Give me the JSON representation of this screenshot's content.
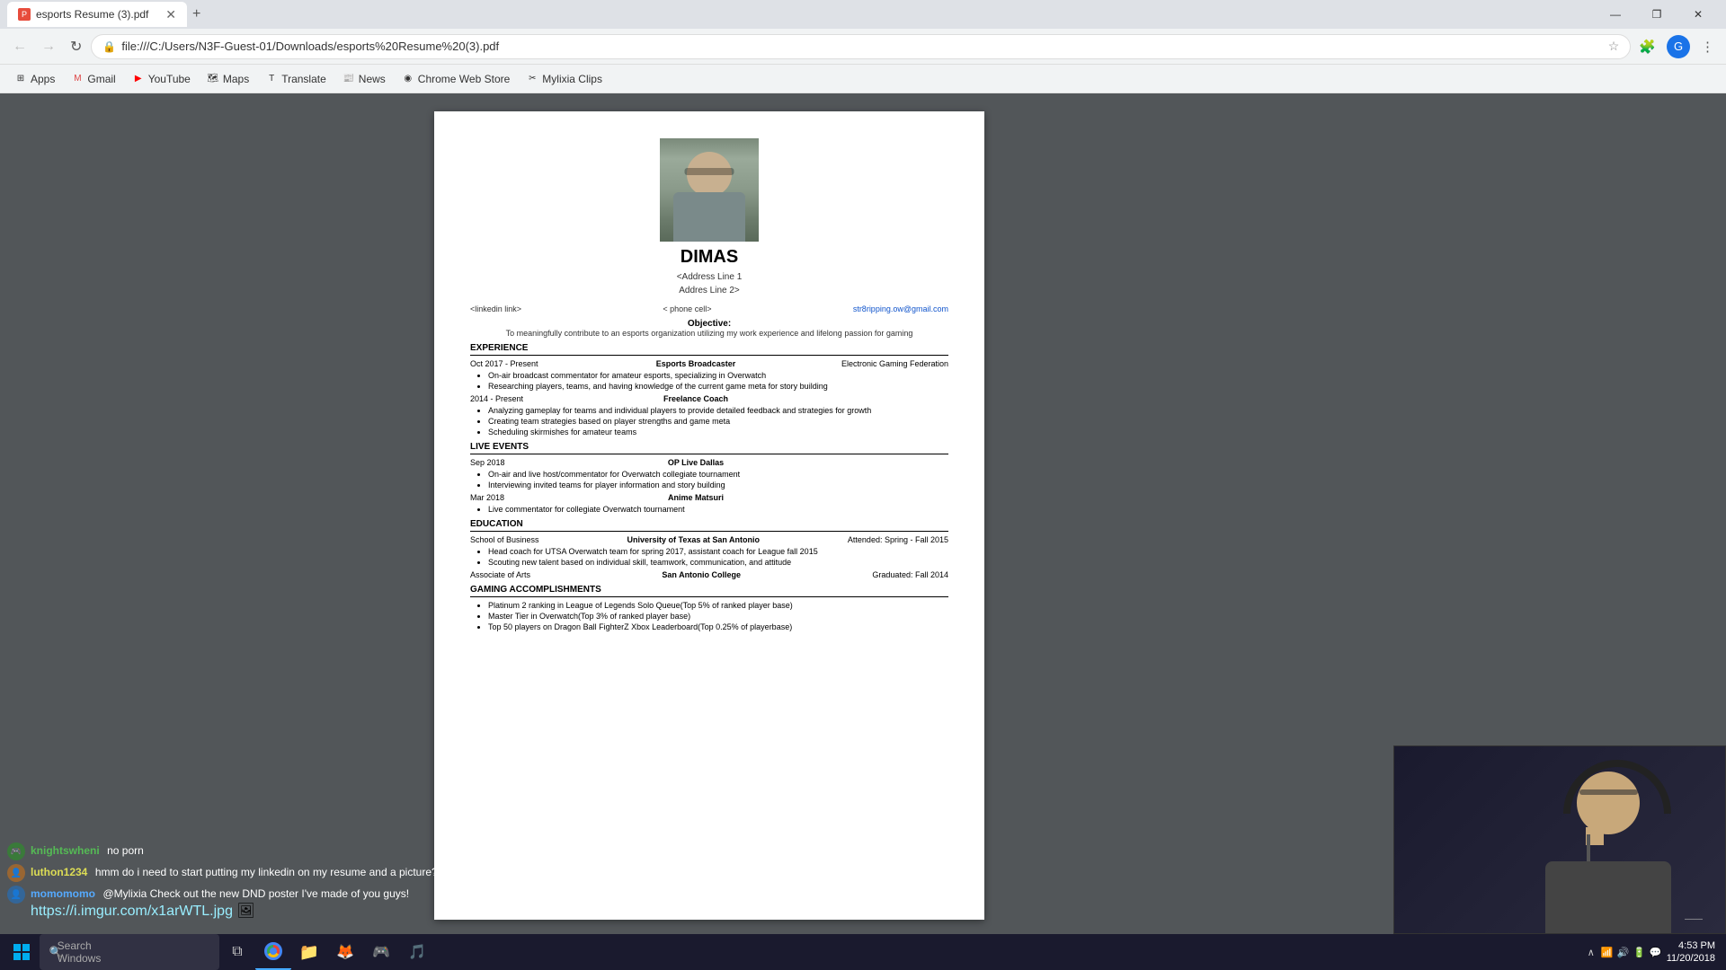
{
  "browser": {
    "tab": {
      "title": "esports Resume (3).pdf",
      "favicon": "pdf"
    },
    "add_tab_label": "+",
    "window_controls": [
      "—",
      "❐",
      "✕"
    ],
    "nav": {
      "back_disabled": true,
      "forward_disabled": true,
      "refresh_label": "↻",
      "address": "file:///C:/Users/N3F-Guest-01/Downloads/esports%20Resume%20(3).pdf",
      "lock_icon": "🔒"
    },
    "bookmarks": [
      {
        "label": "Apps",
        "icon": "⊞"
      },
      {
        "label": "Gmail",
        "icon": "M"
      },
      {
        "label": "YouTube",
        "icon": "▶"
      },
      {
        "label": "Maps",
        "icon": "📍"
      },
      {
        "label": "Translate",
        "icon": "T"
      },
      {
        "label": "News",
        "icon": "N"
      },
      {
        "label": "Chrome Web Store",
        "icon": "◉"
      },
      {
        "label": "Mylixia Clips",
        "icon": "✂"
      }
    ]
  },
  "resume": {
    "name": "DIMAS",
    "address_line1": "<Address Line 1",
    "address_line2": "Addres Line 2>",
    "linkedin": "<linkedin link>",
    "phone": "< phone cell>",
    "email": "str8ripping.ow@gmail.com",
    "objective_title": "Objective:",
    "objective_text": "To meaningfully contribute to an esports organization utilizing my work experience and lifelong passion for gaming",
    "experience_title": "EXPERIENCE",
    "experience": [
      {
        "date": "Oct 2017 - Present",
        "role": "Esports Broadcaster",
        "org": "Electronic Gaming Federation",
        "bullets": [
          "On-air broadcast commentator for amateur esports, specializing in Overwatch",
          "Researching players, teams, and having knowledge of the current game meta for story building"
        ]
      },
      {
        "date": "2014 - Present",
        "role": "Freelance Coach",
        "org": "",
        "bullets": [
          "Analyzing gameplay for teams and individual players to provide detailed feedback and strategies for growth",
          "Creating team strategies based on player strengths and game meta",
          "Scheduling skirmishes for amateur teams"
        ]
      }
    ],
    "live_events_title": "LIVE EVENTS",
    "live_events": [
      {
        "date": "Sep 2018",
        "event": "OP Live Dallas",
        "bullets": [
          "On-air and live host/commentator for Overwatch collegiate tournament",
          "Interviewing invited teams for player information and story building"
        ]
      },
      {
        "date": "Mar 2018",
        "event": "Anime Matsuri",
        "bullets": [
          "Live commentator for collegiate Overwatch tournament"
        ]
      }
    ],
    "education_title": "EDUCATION",
    "education": [
      {
        "school": "School of Business",
        "institution": "University of Texas at San Antonio",
        "date": "Attended: Spring - Fall 2015",
        "bullets": [
          "Head coach for UTSA Overwatch team for spring 2017, assistant coach for League fall 2015",
          "Scouting new talent based on individual skill, teamwork, communication, and attitude"
        ]
      },
      {
        "school": "Associate of Arts",
        "institution": "San Antonio College",
        "date": "Graduated: Fall 2014",
        "bullets": []
      }
    ],
    "gaming_title": "ING ACCOMPLISHMENTS",
    "gaming_bullets": [
      "Platinum 2 ranking in League of Legends Solo Queue(Top 5% of ranked player base)",
      "Master Tier in Overwatch(Top 3% of ranked player base)",
      "Top 50 players on Dragon Ball FighterZ Xbox Leaderboard(Top 0.25% of playerbase)"
    ]
  },
  "chat": {
    "messages": [
      {
        "username": "knightswheni",
        "username_color": "#5b5",
        "icon_color": "#3a3",
        "text": "no porn"
      },
      {
        "username": "luthon1234",
        "username_color": "#dd5",
        "icon_color": "#996",
        "text": "hmm do i need to start putting my linkedin on my resume and a picture?"
      },
      {
        "username": "momomomo",
        "username_color": "#5af",
        "icon_color": "#369",
        "text": "@Mylixia Check out the new DND poster I've made of you guys! https://i.imgur.com/x1arWTL.jpg"
      }
    ]
  },
  "taskbar": {
    "time": "4:53 PM",
    "date": "11/20/2018"
  }
}
